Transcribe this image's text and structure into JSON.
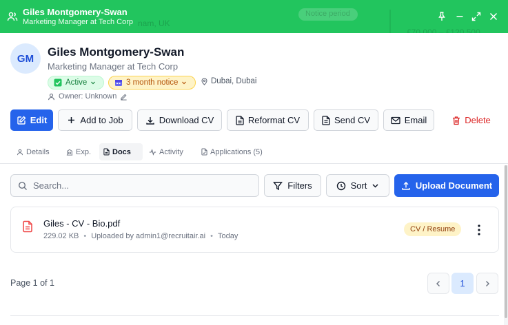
{
  "titlebar": {
    "name": "Giles Montgomery-Swan",
    "subtitle": "Marketing Manager at Tech Corp",
    "bg_color": "#22c55e"
  },
  "profile": {
    "initials": "GM",
    "name": "Giles Montgomery-Swan",
    "title": "Marketing Manager at Tech Corp",
    "status": "Active",
    "notice": "3 month notice",
    "location": "Dubai, Dubai",
    "owner": "Owner: Unknown"
  },
  "actions": {
    "edit": "Edit",
    "add_to_job": "Add to Job",
    "download_cv": "Download CV",
    "reformat_cv": "Reformat CV",
    "send_cv": "Send CV",
    "email": "Email",
    "delete": "Delete"
  },
  "tabs": [
    {
      "label": "Details",
      "icon": "user-icon"
    },
    {
      "label": "Exp.",
      "icon": "building-icon"
    },
    {
      "label": "Docs",
      "icon": "file-icon",
      "active": true
    },
    {
      "label": "Activity",
      "icon": "activity-icon"
    },
    {
      "label": "Applications (5)",
      "icon": "file-check-icon"
    }
  ],
  "toolbar": {
    "search_placeholder": "Search...",
    "filters": "Filters",
    "sort": "Sort",
    "upload": "Upload Document"
  },
  "documents": [
    {
      "name": "Giles - CV - Bio.pdf",
      "size": "229.02 KB",
      "uploaded_by": "Uploaded by admin1@recruitair.ai",
      "date": "Today",
      "type": "CV / Resume"
    }
  ],
  "pagination": {
    "info": "Page 1 of 1",
    "current": "1"
  },
  "colors": {
    "primary": "#2563eb",
    "danger": "#dc2626",
    "success": "#15803d",
    "warning": "#b45309"
  }
}
